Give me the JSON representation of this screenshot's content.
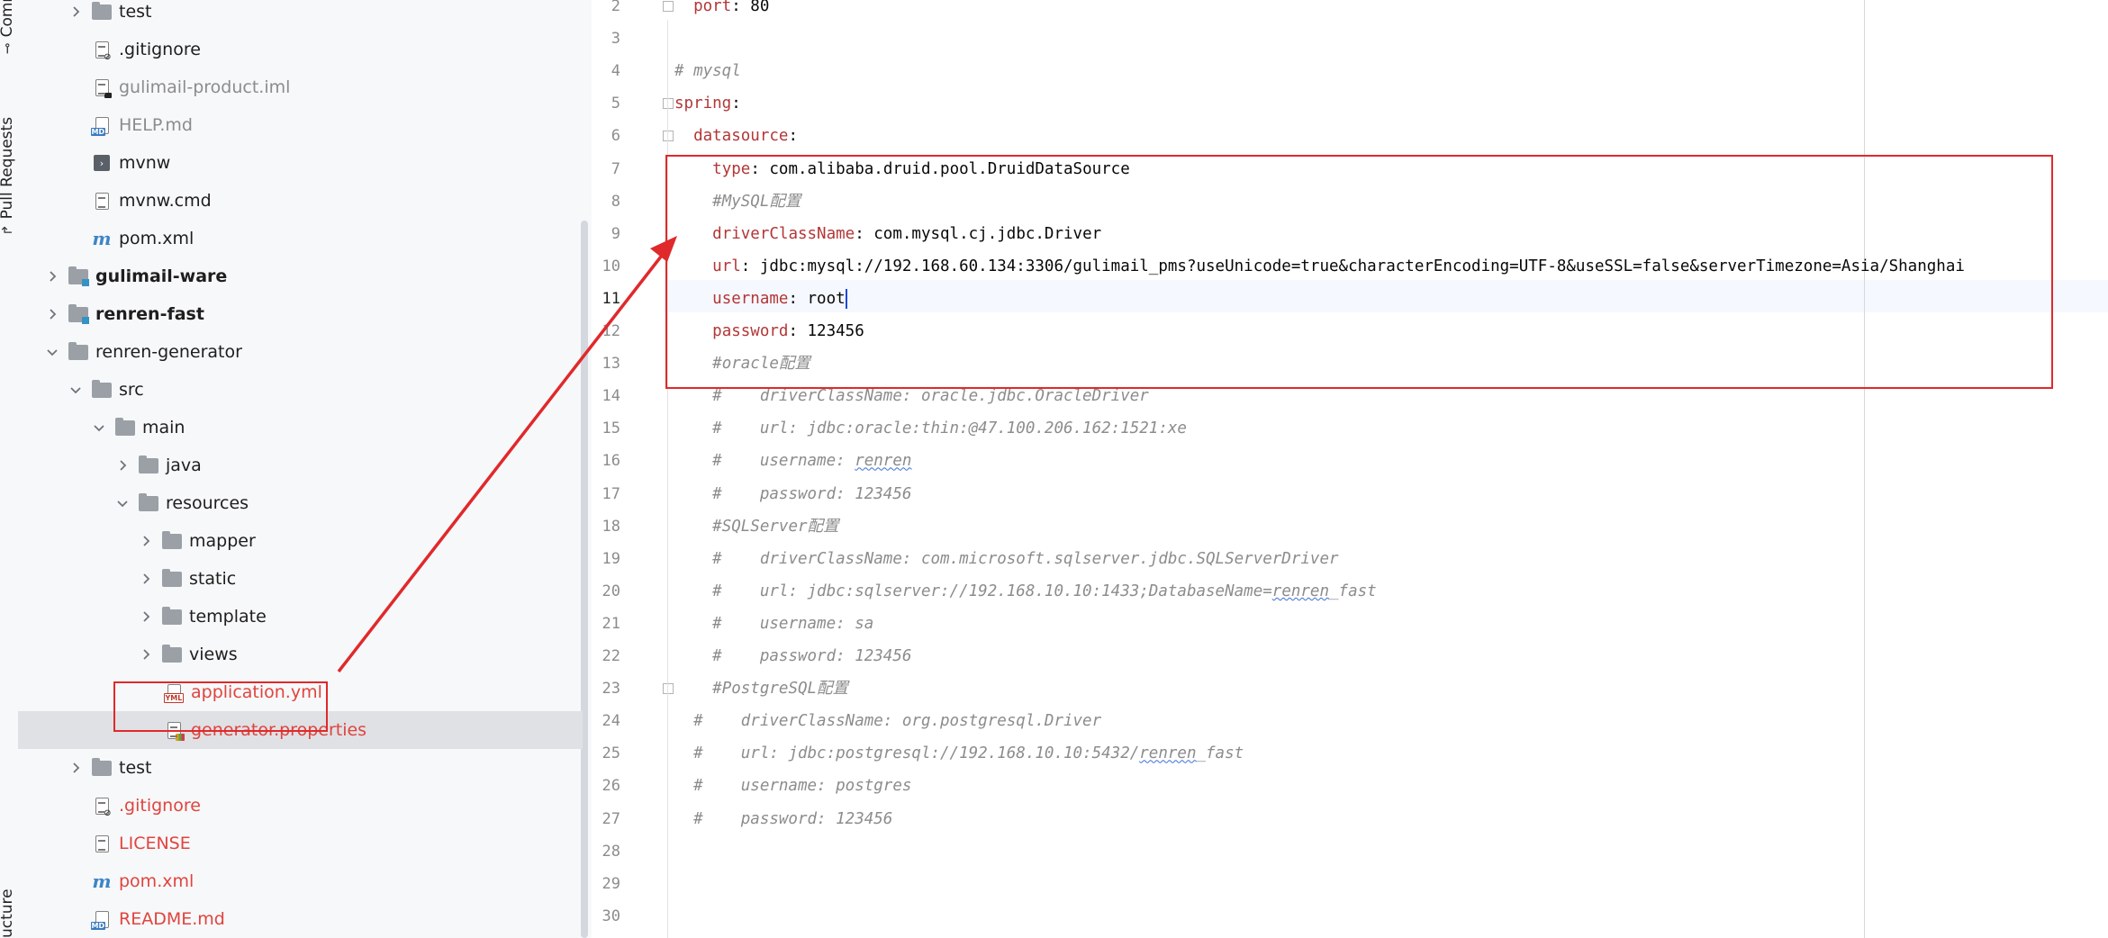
{
  "side_tabs": {
    "commit": "Commit",
    "pull_requests": "Pull Requests",
    "structure": "ucture"
  },
  "tree": [
    {
      "label": "test",
      "type": "folder",
      "indent": 1,
      "chevron": "right",
      "style": ""
    },
    {
      "label": ".gitignore",
      "type": "gitignore",
      "indent": 1,
      "chevron": "",
      "style": ""
    },
    {
      "label": "gulimail-product.iml",
      "type": "iml",
      "indent": 1,
      "chevron": "",
      "style": "grey"
    },
    {
      "label": "HELP.md",
      "type": "md",
      "indent": 1,
      "chevron": "",
      "style": "grey"
    },
    {
      "label": "mvnw",
      "type": "mvnw",
      "indent": 1,
      "chevron": "",
      "style": ""
    },
    {
      "label": "mvnw.cmd",
      "type": "text",
      "indent": 1,
      "chevron": "",
      "style": ""
    },
    {
      "label": "pom.xml",
      "type": "maven",
      "indent": 1,
      "chevron": "",
      "style": ""
    },
    {
      "label": "gulimail-ware",
      "type": "module",
      "indent": 0,
      "chevron": "right",
      "style": "bold"
    },
    {
      "label": "renren-fast",
      "type": "module",
      "indent": 0,
      "chevron": "right",
      "style": "bold"
    },
    {
      "label": "renren-generator",
      "type": "folder",
      "indent": 0,
      "chevron": "down",
      "style": ""
    },
    {
      "label": "src",
      "type": "folder",
      "indent": 1,
      "chevron": "down",
      "style": ""
    },
    {
      "label": "main",
      "type": "folder",
      "indent": 2,
      "chevron": "down",
      "style": ""
    },
    {
      "label": "java",
      "type": "folder",
      "indent": 3,
      "chevron": "right",
      "style": ""
    },
    {
      "label": "resources",
      "type": "folder",
      "indent": 3,
      "chevron": "down",
      "style": ""
    },
    {
      "label": "mapper",
      "type": "folder",
      "indent": 4,
      "chevron": "right",
      "style": ""
    },
    {
      "label": "static",
      "type": "folder",
      "indent": 4,
      "chevron": "right",
      "style": ""
    },
    {
      "label": "template",
      "type": "folder",
      "indent": 4,
      "chevron": "right",
      "style": ""
    },
    {
      "label": "views",
      "type": "folder",
      "indent": 4,
      "chevron": "right",
      "style": ""
    },
    {
      "label": "application.yml",
      "type": "yml",
      "indent": 4,
      "chevron": "",
      "style": "red"
    },
    {
      "label": "generator.properties",
      "type": "properties",
      "indent": 4,
      "chevron": "",
      "style": "red selected"
    },
    {
      "label": "test",
      "type": "folder",
      "indent": 1,
      "chevron": "right",
      "style": ""
    },
    {
      "label": ".gitignore",
      "type": "gitignore",
      "indent": 1,
      "chevron": "",
      "style": "red"
    },
    {
      "label": "LICENSE",
      "type": "text",
      "indent": 1,
      "chevron": "",
      "style": "red"
    },
    {
      "label": "pom.xml",
      "type": "maven",
      "indent": 1,
      "chevron": "",
      "style": "red"
    },
    {
      "label": "README.md",
      "type": "md",
      "indent": 1,
      "chevron": "",
      "style": "red"
    }
  ],
  "editor": {
    "current_line": "11",
    "lines": [
      {
        "num": "2",
        "fold": true,
        "parts": [
          [
            "ind",
            "  "
          ],
          [
            "k",
            "port"
          ],
          [
            "v",
            ": 80"
          ]
        ]
      },
      {
        "num": "3",
        "parts": []
      },
      {
        "num": "4",
        "parts": [
          [
            "c",
            "# mysql"
          ]
        ]
      },
      {
        "num": "5",
        "fold": true,
        "parts": [
          [
            "k",
            "spring"
          ],
          [
            "v",
            ":"
          ]
        ]
      },
      {
        "num": "6",
        "fold": true,
        "parts": [
          [
            "ind",
            "  "
          ],
          [
            "k",
            "datasource"
          ],
          [
            "v",
            ":"
          ]
        ]
      },
      {
        "num": "7",
        "parts": [
          [
            "ind",
            "    "
          ],
          [
            "k",
            "type"
          ],
          [
            "v",
            ": com.alibaba.druid.pool.DruidDataSource"
          ]
        ]
      },
      {
        "num": "8",
        "parts": [
          [
            "ind",
            "    "
          ],
          [
            "c",
            "#MySQL配置"
          ]
        ]
      },
      {
        "num": "9",
        "parts": [
          [
            "ind",
            "    "
          ],
          [
            "k",
            "driverClassName"
          ],
          [
            "v",
            ": com.mysql.cj.jdbc.Driver"
          ]
        ]
      },
      {
        "num": "10",
        "parts": [
          [
            "ind",
            "    "
          ],
          [
            "k",
            "url"
          ],
          [
            "v",
            ": jdbc:mysql://192.168.60.134:3306/gulimail_pms?useUnicode=true&characterEncoding=UTF-8&useSSL=false&serverTimezone=Asia/Shanghai"
          ]
        ]
      },
      {
        "num": "11",
        "caret": true,
        "parts": [
          [
            "ind",
            "    "
          ],
          [
            "k",
            "username"
          ],
          [
            "v",
            ": root"
          ]
        ]
      },
      {
        "num": "12",
        "parts": [
          [
            "ind",
            "    "
          ],
          [
            "k",
            "password"
          ],
          [
            "v",
            ": 123456"
          ]
        ]
      },
      {
        "num": "13",
        "parts": [
          [
            "ind",
            "    "
          ],
          [
            "c",
            "#oracle配置"
          ]
        ]
      },
      {
        "num": "14",
        "parts": [
          [
            "ind",
            "    "
          ],
          [
            "c",
            "#    driverClassName: oracle.jdbc.OracleDriver"
          ]
        ]
      },
      {
        "num": "15",
        "parts": [
          [
            "ind",
            "    "
          ],
          [
            "c",
            "#    url: jdbc:oracle:thin:@47.100.206.162:1521:xe"
          ]
        ]
      },
      {
        "num": "16",
        "parts": [
          [
            "ind",
            "    "
          ],
          [
            "c",
            "#    username: "
          ],
          [
            "cw",
            "renren"
          ]
        ]
      },
      {
        "num": "17",
        "parts": [
          [
            "ind",
            "    "
          ],
          [
            "c",
            "#    password: 123456"
          ]
        ]
      },
      {
        "num": "18",
        "parts": [
          [
            "ind",
            "    "
          ],
          [
            "c",
            "#SQLServer配置"
          ]
        ]
      },
      {
        "num": "19",
        "parts": [
          [
            "ind",
            "    "
          ],
          [
            "c",
            "#    driverClassName: com.microsoft.sqlserver.jdbc.SQLServerDriver"
          ]
        ]
      },
      {
        "num": "20",
        "parts": [
          [
            "ind",
            "    "
          ],
          [
            "c",
            "#    url: jdbc:sqlserver://192.168.10.10:1433;DatabaseName="
          ],
          [
            "cw",
            "renren"
          ],
          [
            "c",
            "_fast"
          ]
        ]
      },
      {
        "num": "21",
        "parts": [
          [
            "ind",
            "    "
          ],
          [
            "c",
            "#    username: sa"
          ]
        ]
      },
      {
        "num": "22",
        "parts": [
          [
            "ind",
            "    "
          ],
          [
            "c",
            "#    password: 123456"
          ]
        ]
      },
      {
        "num": "23",
        "fold": true,
        "parts": [
          [
            "ind",
            "    "
          ],
          [
            "c",
            "#PostgreSQL配置"
          ]
        ]
      },
      {
        "num": "24",
        "parts": [
          [
            "ind",
            "  "
          ],
          [
            "c",
            "#    driverClassName: org.postgresql.Driver"
          ]
        ]
      },
      {
        "num": "25",
        "parts": [
          [
            "ind",
            "  "
          ],
          [
            "c",
            "#    url: jdbc:postgresql://192.168.10.10:5432/"
          ],
          [
            "cw",
            "renren"
          ],
          [
            "c",
            "_fast"
          ]
        ]
      },
      {
        "num": "26",
        "parts": [
          [
            "ind",
            "  "
          ],
          [
            "c",
            "#    username: postgres"
          ]
        ]
      },
      {
        "num": "27",
        "parts": [
          [
            "ind",
            "  "
          ],
          [
            "c",
            "#    password: 123456"
          ]
        ]
      },
      {
        "num": "28",
        "parts": []
      },
      {
        "num": "29",
        "parts": []
      },
      {
        "num": "30",
        "parts": []
      }
    ]
  },
  "colors": {
    "annotation": "#e0292b",
    "yaml_key": "#b33636",
    "comment": "#8c8c8c",
    "vcs_new_file": "#e0443e"
  }
}
